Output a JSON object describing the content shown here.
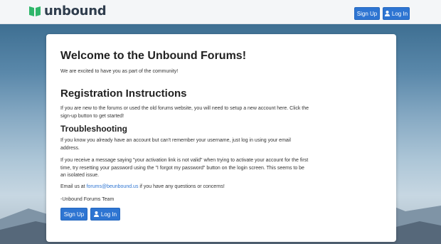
{
  "header": {
    "logo_text": "unbound",
    "signup_label": "Sign Up",
    "login_label": "Log In"
  },
  "content": {
    "welcome_title": "Welcome to the Unbound Forums!",
    "welcome_text": "We are excited to have you as part of the community!",
    "registration_title": "Registration Instructions",
    "registration_text": "If you are new to the forums or used the old forums website, you will need to setup a new account here. Click the sign-up button to get started!",
    "troubleshooting_title": "Troubleshooting",
    "troubleshooting_text_1": "If you know you already have an account but can't remember your username, just log in using your email address.",
    "troubleshooting_text_2": "If you receive a message saying \"your activation link is not valid\" when trying to activate your account for the first time, try resetting your password using the \"I forgot my password\" button on the login screen. This seems to be an isolated issue.",
    "email_prefix": "Email us at",
    "email_link": "forums@beunbound.us",
    "email_suffix": "if you have any questions or concerns!",
    "signoff": "-Unbound Forums Team",
    "signup_label": "Sign Up",
    "login_label": "Log In"
  },
  "colors": {
    "accent": "#2e75d2",
    "logo_green": "#2fb66a",
    "text_dark": "#222222"
  },
  "icons": {
    "logo": "book-icon",
    "user": "user-icon"
  }
}
